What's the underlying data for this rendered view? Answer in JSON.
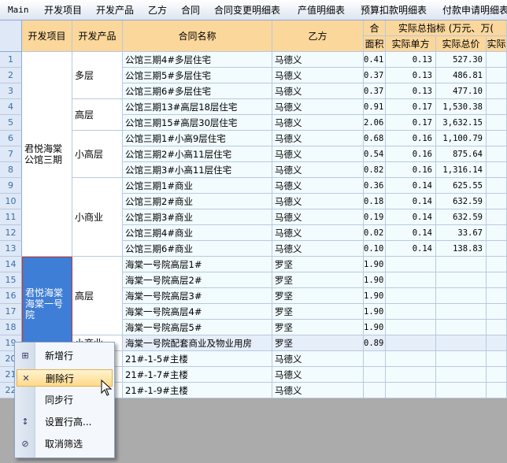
{
  "menubar": [
    {
      "label": "Main",
      "name": "menu-main"
    },
    {
      "label": "开发项目",
      "name": "menu-dev-project"
    },
    {
      "label": "开发产品",
      "name": "menu-dev-product"
    },
    {
      "label": "乙方",
      "name": "menu-party-b"
    },
    {
      "label": "合同",
      "name": "menu-contract"
    },
    {
      "label": "合同变更明细表",
      "name": "menu-contract-change"
    },
    {
      "label": "产值明细表",
      "name": "menu-output-value"
    },
    {
      "label": "预算扣款明细表",
      "name": "menu-budget-deduction"
    },
    {
      "label": "付款申请明细表",
      "name": "menu-payment-request"
    }
  ],
  "headers": {
    "project": "开发项目",
    "product": "开发产品",
    "contract_name": "合同名称",
    "party_b": "乙方",
    "he": "合",
    "area": "面积",
    "actual_group": "实际总指标 (万元、万(",
    "unit_price": "实际单方",
    "total_price": "实际总价",
    "extra": "实际"
  },
  "project_groups": [
    {
      "name": "君悦海棠公馆三期"
    },
    {
      "name": "君悦海棠海棠一号院"
    }
  ],
  "product_groups": [
    {
      "name": "多层"
    },
    {
      "name": "高层"
    },
    {
      "name": "小高层"
    },
    {
      "name": "小商业"
    },
    {
      "name": "高层"
    },
    {
      "name": "小商业"
    }
  ],
  "rows": [
    {
      "n": "1",
      "contract": "公馆三期4#多层住宅",
      "party": "马德义",
      "area": "0.41",
      "unit": "0.13",
      "total": "527.30"
    },
    {
      "n": "2",
      "contract": "公馆三期5#多层住宅",
      "party": "马德义",
      "area": "0.37",
      "unit": "0.13",
      "total": "486.81"
    },
    {
      "n": "3",
      "contract": "公馆三期6#多层住宅",
      "party": "马德义",
      "area": "0.37",
      "unit": "0.13",
      "total": "477.10"
    },
    {
      "n": "4",
      "contract": "公馆三期13#高层18层住宅",
      "party": "马德义",
      "area": "0.91",
      "unit": "0.17",
      "total": "1,530.38"
    },
    {
      "n": "5",
      "contract": "公馆三期15#高层30层住宅",
      "party": "马德义",
      "area": "2.06",
      "unit": "0.17",
      "total": "3,632.15"
    },
    {
      "n": "6",
      "contract": "公馆三期1#小高9层住宅",
      "party": "马德义",
      "area": "0.68",
      "unit": "0.16",
      "total": "1,100.79"
    },
    {
      "n": "7",
      "contract": "公馆三期2#小高11层住宅",
      "party": "马德义",
      "area": "0.54",
      "unit": "0.16",
      "total": "875.64"
    },
    {
      "n": "8",
      "contract": "公馆三期3#小高11层住宅",
      "party": "马德义",
      "area": "0.82",
      "unit": "0.16",
      "total": "1,316.14"
    },
    {
      "n": "9",
      "contract": "公馆三期1#商业",
      "party": "马德义",
      "area": "0.36",
      "unit": "0.14",
      "total": "625.55"
    },
    {
      "n": "10",
      "contract": "公馆三期2#商业",
      "party": "马德义",
      "area": "0.18",
      "unit": "0.14",
      "total": "632.59"
    },
    {
      "n": "11",
      "contract": "公馆三期3#商业",
      "party": "马德义",
      "area": "0.19",
      "unit": "0.14",
      "total": "632.59"
    },
    {
      "n": "12",
      "contract": "公馆三期4#商业",
      "party": "马德义",
      "area": "0.02",
      "unit": "0.14",
      "total": "33.67"
    },
    {
      "n": "13",
      "contract": "公馆三期6#商业",
      "party": "马德义",
      "area": "0.10",
      "unit": "0.14",
      "total": "138.83"
    },
    {
      "n": "14",
      "contract": "海棠一号院高层1#",
      "party": "罗坚",
      "area": "1.90",
      "unit": "",
      "total": ""
    },
    {
      "n": "15",
      "contract": "海棠一号院高层2#",
      "party": "罗坚",
      "area": "1.90",
      "unit": "",
      "total": ""
    },
    {
      "n": "16",
      "contract": "海棠一号院高层3#",
      "party": "罗坚",
      "area": "1.90",
      "unit": "",
      "total": ""
    },
    {
      "n": "17",
      "contract": "海棠一号院高层4#",
      "party": "罗坚",
      "area": "1.90",
      "unit": "",
      "total": ""
    },
    {
      "n": "18",
      "contract": "海棠一号院高层5#",
      "party": "罗坚",
      "area": "1.90",
      "unit": "",
      "total": ""
    },
    {
      "n": "19",
      "contract": "海棠一号院配套商业及物业用房",
      "party": "罗坚",
      "area": "0.89",
      "unit": "",
      "total": ""
    },
    {
      "n": "20",
      "contract": "21#-1-5#主楼",
      "party": "马德义",
      "area": "",
      "unit": "",
      "total": ""
    },
    {
      "n": "21",
      "contract": "21#-1-7#主楼",
      "party": "马德义",
      "area": "",
      "unit": "",
      "total": ""
    },
    {
      "n": "22",
      "contract": "21#-1-9#主楼",
      "party": "马德义",
      "area": "",
      "unit": "",
      "total": ""
    }
  ],
  "context_menu": [
    {
      "label": "新增行",
      "icon": "insert-row-icon",
      "glyph": "⊞",
      "name": "ctx-add-row"
    },
    {
      "label": "删除行",
      "icon": "delete-row-icon",
      "glyph": "✕",
      "name": "ctx-delete-row"
    },
    {
      "label": "同步行",
      "icon": "",
      "glyph": "",
      "name": "ctx-sync-row"
    },
    {
      "label": "设置行高...",
      "icon": "row-height-icon",
      "glyph": "↕",
      "name": "ctx-set-row-height"
    },
    {
      "label": "取消筛选",
      "icon": "clear-filter-icon",
      "glyph": "⊘",
      "name": "ctx-cancel-filter"
    }
  ],
  "colors": {
    "header_bg": "#fbd79b",
    "row_header_bg": "#dfe8f6",
    "cell_bg": "#f2fbfe",
    "selected_merge_bg": "#3f7ed6",
    "selected_border": "#c0392b",
    "hover_bg": "#ffd98a"
  }
}
